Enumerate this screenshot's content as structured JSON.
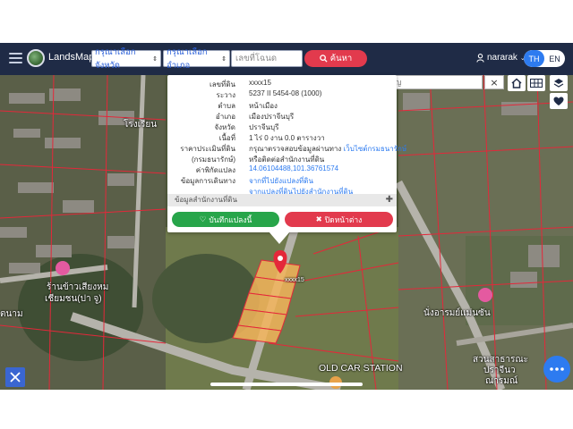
{
  "navbar": {
    "brand": "LandsMaps",
    "province_select": "กรุณาเลือกจังหวัด",
    "district_select": "กรุณาเลือกอำเภอ",
    "deed_placeholder": "เลขที่โฉนด",
    "search_label": "ค้นหา",
    "user_name": "nararak",
    "lang_th": "TH",
    "lang_en": "EN"
  },
  "map_search": {
    "placeholder": "ค้นหาสถานที่สำคัญ",
    "clear": "×"
  },
  "popup": {
    "rows": [
      {
        "label": "เลขที่ดิน",
        "value": "xxxx15"
      },
      {
        "label": "ระวาง",
        "value": "5237 II 5454-08 (1000)"
      },
      {
        "label": "ตำบล",
        "value": "หน้าเมือง"
      },
      {
        "label": "อำเภอ",
        "value": "เมืองปราจีนบุรี"
      },
      {
        "label": "จังหวัด",
        "value": "ปราจีนบุรี"
      },
      {
        "label": "เนื้อที่",
        "value": "1 ไร่ 0 งาน 0.0 ตารางวา"
      },
      {
        "label": "ราคาประเมินที่ดิน",
        "value": "กรุณาตรวจสอบข้อมูลผ่านทาง",
        "link": "เว็บไซต์กรมธนารักษ์"
      },
      {
        "label": "(กรมธนารักษ์)",
        "value": "หรือติดต่อสำนักงานที่ดิน"
      },
      {
        "label": "ค่าพิกัดแปลง",
        "value": "14.06104488,101.36761574"
      },
      {
        "label": "ข้อมูลการเดินทาง",
        "value": "จากที่ไปยังแปลงที่ดิน"
      },
      {
        "label": "",
        "value": "จากแปลงที่ดินไปยังสำนักงานที่ดิน"
      }
    ],
    "section_label": "ข้อมูลสำนักงานที่ดิน",
    "save_label": "บันทึกแปลงนี้",
    "close_label": "ปิดหน้าต่าง"
  },
  "map_labels": {
    "school": "โรงเรียน",
    "rice_shop": "ร้านข้าวเสียงหม",
    "rice_shop_2": "เชียมชน(ปา จู)",
    "restaurant": "นั่งอารมย์แม่นซัน",
    "park_1": "สวนสาธารณะ",
    "park_2": "ปราจีนว",
    "park_3": "ณารมณ์",
    "station": "OLD CAR STATION",
    "left_edge": "ตนาม",
    "plot_number": "xxxx15"
  },
  "colors": {
    "navbar": "#1f2b46",
    "search_button": "#e23a4d",
    "save_button": "#27a54a",
    "accent_blue": "#2d7bf0",
    "plot_fill": "#f3b45a",
    "boundary": "#e4283a"
  }
}
